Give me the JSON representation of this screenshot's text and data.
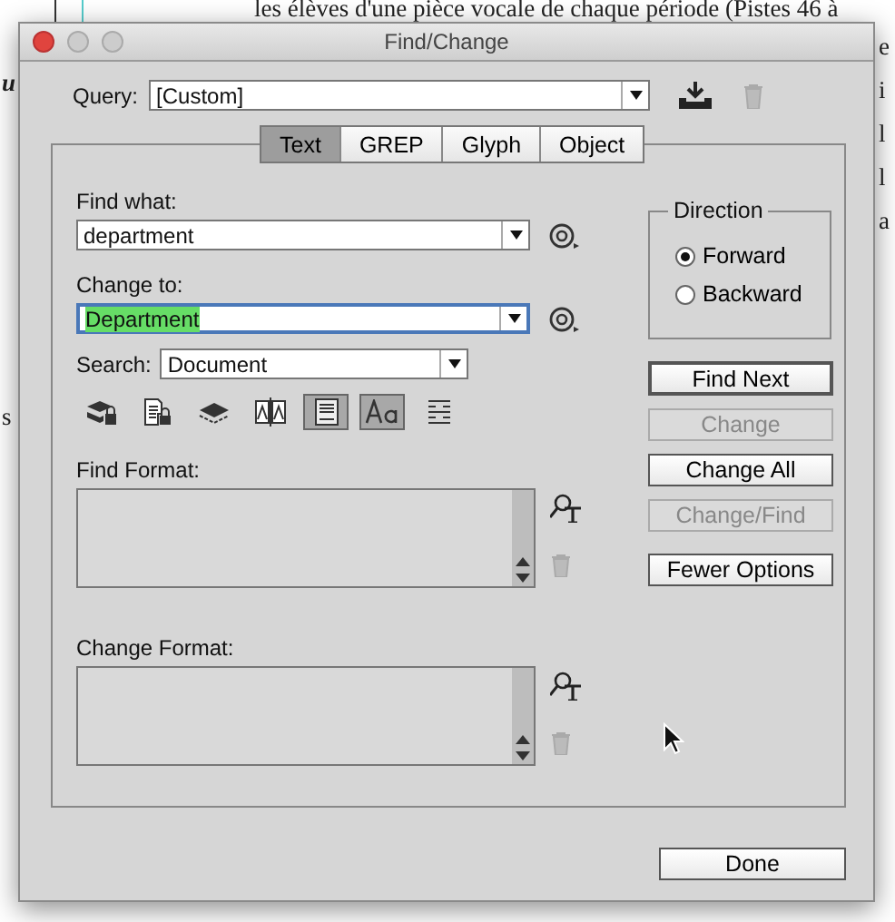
{
  "background_text": [
    {
      "text": "les élèves d'une pièce vocale de chaque période (Pistes 46 à",
      "kind": "plain"
    },
    {
      "text": "u",
      "kind": "bold-italic"
    },
    {
      "text": "e",
      "kind": "plain"
    },
    {
      "text": "i",
      "kind": "plain"
    },
    {
      "text": "l",
      "kind": "plain"
    },
    {
      "text": "l",
      "kind": "plain"
    },
    {
      "text": "a",
      "kind": "plain"
    },
    {
      "text": "s",
      "kind": "plain"
    }
  ],
  "window": {
    "title": "Find/Change"
  },
  "query": {
    "label": "Query:",
    "value": "[Custom]"
  },
  "tabs": [
    {
      "label": "Text",
      "selected": true
    },
    {
      "label": "GREP",
      "selected": false
    },
    {
      "label": "Glyph",
      "selected": false
    },
    {
      "label": "Object",
      "selected": false
    }
  ],
  "find_what": {
    "label": "Find what:",
    "value": "department"
  },
  "change_to": {
    "label": "Change to:",
    "value": "Department",
    "focused": true
  },
  "search": {
    "label": "Search:",
    "value": "Document"
  },
  "options": [
    {
      "kind": "locked-layers",
      "selected": false
    },
    {
      "kind": "locked-stories",
      "selected": false
    },
    {
      "kind": "hidden-layers",
      "selected": false
    },
    {
      "kind": "master-pages",
      "selected": false
    },
    {
      "kind": "footnotes",
      "selected": true
    },
    {
      "kind": "case-sensitive",
      "selected": true
    },
    {
      "kind": "whole-word",
      "selected": false
    }
  ],
  "find_format": {
    "label": "Find Format:"
  },
  "change_format": {
    "label": "Change Format:"
  },
  "direction": {
    "label": "Direction",
    "options": [
      {
        "label": "Forward",
        "selected": true
      },
      {
        "label": "Backward",
        "selected": false
      }
    ]
  },
  "buttons": [
    {
      "label": "Find Next",
      "default": true,
      "disabled": false
    },
    {
      "label": "Change",
      "default": false,
      "disabled": true
    },
    {
      "label": "Change All",
      "default": false,
      "disabled": false
    },
    {
      "label": "Change/Find",
      "default": false,
      "disabled": true
    },
    {
      "label": "Fewer Options",
      "default": false,
      "disabled": false
    }
  ],
  "done_button": {
    "label": "Done"
  }
}
